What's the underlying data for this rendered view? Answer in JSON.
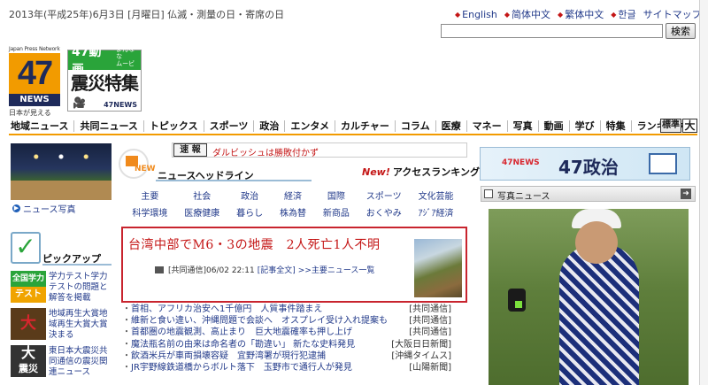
{
  "header": {
    "date_line": "2013年(平成25年)6月3日 [月曜日] 仏滅・測量の日・寄席の日",
    "languages": [
      {
        "label": "English"
      },
      {
        "label": "简体中文"
      },
      {
        "label": "繁体中文"
      },
      {
        "label": "한글"
      }
    ],
    "sitemap_label": "サイトマップ",
    "search_placeholder": "",
    "search_button": "検索"
  },
  "logos": {
    "main": {
      "network": "Japan Press Network",
      "number": "47",
      "news": "NEWS",
      "tagline": "日本が見える"
    },
    "shinsai": {
      "video": "47動画",
      "video_sub1": "よんなな",
      "video_sub2": "ムービー",
      "title": "震災特集",
      "brand": "47NEWS"
    }
  },
  "nav": {
    "items": [
      "地域ニュース",
      "共同ニュース",
      "トピックス",
      "スポーツ",
      "政治",
      "エンタメ",
      "カルチャー",
      "コラム",
      "医療",
      "マネー",
      "写真",
      "動画",
      "学び",
      "特集",
      "ランキング"
    ],
    "font_std": "標準",
    "font_large": "大"
  },
  "left": {
    "news_photo_label": "ニュース写真",
    "pickup_title": "ピックアップ",
    "pickups": [
      {
        "thumb_line1": "全国学力",
        "thumb_line2": "テスト",
        "text": "学力テスト学力テストの問題と解答を掲載"
      },
      {
        "thumb": "大",
        "text": "地域再生大賞地域再生大賞大賞決まる"
      },
      {
        "thumb_line1": "大",
        "thumb_line2": "震災",
        "text": "東日本大震災共同通信の震災関連ニュース"
      }
    ]
  },
  "center": {
    "flash_badge": "速 報",
    "flash_text": "ダルビッシュは勝敗付かず",
    "new_label": "NEW",
    "headline_title": "ニュースヘッドライン",
    "access_new": "New!",
    "access_label": "アクセスランキング",
    "categories": [
      "主要",
      "社会",
      "政治",
      "経済",
      "国際",
      "スポーツ",
      "文化芸能",
      "科学環境",
      "医療健康",
      "暮らし",
      "株為替",
      "新商品",
      "おくやみ",
      "ｱｼﾞｱ経済"
    ],
    "top_story": {
      "headline": "台湾中部でM6・3の地震　2人死亡1人不明",
      "source": "[共同通信]06/02 22:11",
      "full_text_link": "[記事全文]",
      "more_link": ">>主要ニュース一覧"
    },
    "news_list": [
      {
        "title": "首相、アフリカ治安へ1千億円　人質事件踏まえ",
        "source": "[共同通信]"
      },
      {
        "title": "維新と食い違い、沖縄問題で会談へ　オスプレイ受け入れ提案も",
        "source": "[共同通信]"
      },
      {
        "title": "首都圏の地震観測、高止まり　巨大地震確率も押し上げ",
        "source": "[共同通信]"
      },
      {
        "title": "魔法瓶名前の由来は命名者の「勘違い」 新たな史料発見",
        "source": "[大阪日日新聞]"
      },
      {
        "title": "飲酒米兵が車両損壊容疑　宜野湾署が現行犯逮捕",
        "source": "[沖縄タイムス]"
      },
      {
        "title": "JR宇野線鉄道橋からボルト落下　玉野市で通行人が発見",
        "source": "[山陽新聞]"
      }
    ]
  },
  "right": {
    "banner_small": "47NEWS",
    "banner_big": "47政治",
    "photo_news_label": "写真ニュース"
  }
}
